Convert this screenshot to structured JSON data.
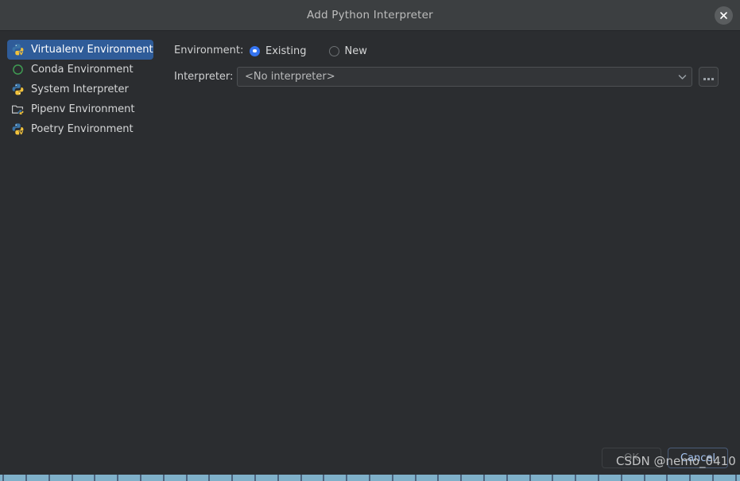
{
  "window": {
    "title": "Add Python Interpreter",
    "close_icon": "close-icon"
  },
  "sidebar": {
    "items": [
      {
        "label": "Virtualenv Environment",
        "icon": "python-venv-icon",
        "selected": true
      },
      {
        "label": "Conda Environment",
        "icon": "conda-circle-icon",
        "selected": false
      },
      {
        "label": "System Interpreter",
        "icon": "python-icon",
        "selected": false
      },
      {
        "label": "Pipenv Environment",
        "icon": "folder-pipenv-icon",
        "selected": false
      },
      {
        "label": "Poetry Environment",
        "icon": "python-poetry-icon",
        "selected": false
      }
    ]
  },
  "form": {
    "environment_label": "Environment:",
    "environment_options": [
      {
        "label": "Existing",
        "selected": true
      },
      {
        "label": "New",
        "selected": false
      }
    ],
    "interpreter_label": "Interpreter:",
    "interpreter_value": "<No interpreter>",
    "browse_label": "...",
    "dropdown_icon": "chevron-down-icon"
  },
  "footer": {
    "ok_label": "OK",
    "cancel_label": "Cancel"
  },
  "watermark": {
    "text": "CSDN @nemo_0410"
  },
  "colors": {
    "titlebar": "#3c3f41",
    "body": "#2b2d30",
    "selection": "#2f5c99",
    "accent": "#3574f0",
    "field": "#333538",
    "border": "#4d5053",
    "text": "#d5d6d7",
    "muted": "#6e7173",
    "cancel_text": "#a5c3f0"
  }
}
